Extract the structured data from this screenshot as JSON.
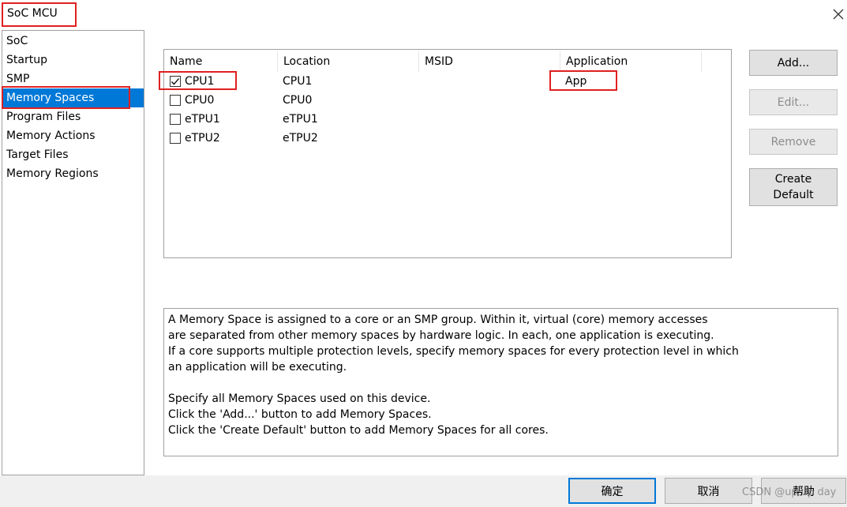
{
  "window": {
    "title": "SoC MCU"
  },
  "sidebar": {
    "items": [
      {
        "label": "SoC"
      },
      {
        "label": "Startup"
      },
      {
        "label": "SMP"
      },
      {
        "label": "Memory Spaces",
        "selected": true
      },
      {
        "label": "Program Files"
      },
      {
        "label": "Memory Actions"
      },
      {
        "label": "Target Files"
      },
      {
        "label": "Memory Regions"
      }
    ]
  },
  "table": {
    "columns": [
      "Name",
      "Location",
      "MSID",
      "Application"
    ],
    "rows": [
      {
        "checked": true,
        "name": "CPU1",
        "location": "CPU1",
        "msid": "",
        "application": "App"
      },
      {
        "checked": false,
        "name": "CPU0",
        "location": "CPU0",
        "msid": "",
        "application": ""
      },
      {
        "checked": false,
        "name": "eTPU1",
        "location": "eTPU1",
        "msid": "",
        "application": ""
      },
      {
        "checked": false,
        "name": "eTPU2",
        "location": "eTPU2",
        "msid": "",
        "application": ""
      }
    ]
  },
  "buttons": {
    "add": "Add...",
    "edit": "Edit...",
    "remove": "Remove",
    "create_default_line1": "Create",
    "create_default_line2": "Default"
  },
  "description": {
    "lines": [
      "A Memory Space is assigned to a core or an SMP group. Within it, virtual (core) memory accesses",
      "are separated from other memory spaces by hardware logic. In each, one application is executing.",
      "If a core supports multiple protection levels, specify memory spaces for every protection level in which",
      "an application will be executing.",
      "",
      "Specify all Memory Spaces used on this device.",
      "Click the 'Add...' button to add Memory Spaces.",
      "Click the 'Create Default' button to add Memory Spaces for all cores."
    ]
  },
  "footer": {
    "ok": "确定",
    "cancel": "取消",
    "help": "帮助",
    "watermark": "CSDN @up up day"
  },
  "colors": {
    "accent": "#0078d7",
    "highlight": "#e02020"
  }
}
